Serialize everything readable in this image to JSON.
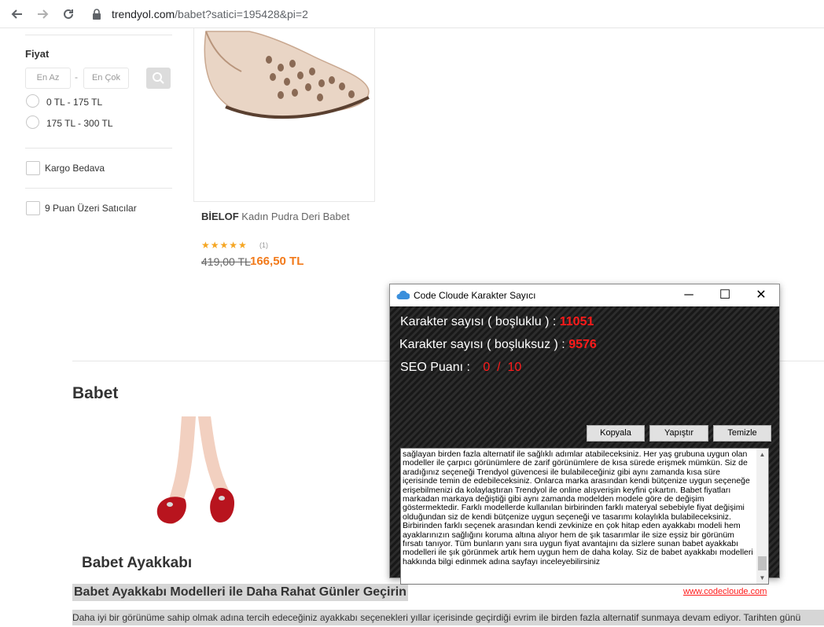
{
  "browser": {
    "back_icon": "arrow-left-icon",
    "forward_icon": "arrow-right-icon",
    "reload_icon": "reload-icon",
    "url_domain": "trendyol.com",
    "url_path": "/babet?satici=195428&pi=2"
  },
  "filters": {
    "price_title": "Fiyat",
    "min_placeholder": "En Az",
    "dash": "-",
    "max_placeholder": "En Çok",
    "ranges": [
      "0 TL - 175 TL",
      "175 TL - 300 TL"
    ],
    "free_shipping": "Kargo Bedava",
    "top_sellers": "9 Puan Üzeri Satıcılar"
  },
  "product": {
    "brand": "BİELOF",
    "name": "Kadın Pudra Deri Babet",
    "rating": 5,
    "stars": "★★★★★",
    "review_count": "(1)",
    "old_price": "419,00 TL",
    "new_price": "166,50 TL"
  },
  "content": {
    "title": "Babet",
    "subtitle": "Babet Ayakkabı",
    "heading": "Babet Ayakkabı Modelleri ile Daha Rahat Günler Geçirin",
    "paragraph": "Daha iyi bir görünüme sahip olmak adına tercih edeceğiniz ayakkabı seçenekleri yıllar içerisinde geçirdiği evrim ile birden fazla alternatif sunmaya devam ediyor. Tarihten günü"
  },
  "app": {
    "title": "Code Cloude Karakter Sayıcı",
    "minimize": "─",
    "maximize": "☐",
    "close": "✕",
    "with_spaces_label": "Karakter sayısı ( boşluklu ) :",
    "with_spaces_value": "11051",
    "without_spaces_label": "Karakter sayısı ( boşluksuz ) :",
    "without_spaces_value": "9576",
    "seo_label": "SEO Puanı :",
    "seo_value": "0  /  10",
    "copy_button": "Kopyala",
    "paste_button": "Yapıştır",
    "clear_button": "Temizle",
    "text": "sağlayan birden fazla alternatif ile sağlıklı adımlar atabileceksiniz. Her yaş grubuna uygun olan modeller ile çarpıcı görünümlere de zarif görünümlere de kısa sürede erişmek mümkün. Siz de aradığınız seçeneği Trendyol güvencesi ile bulabileceğiniz gibi aynı zamanda kısa süre içerisinde temin de edebileceksiniz. Onlarca marka arasından kendi bütçenize uygun seçeneğe erişebilmenizi da kolaylaştıran Trendyol ile online alışverişin keyfini çıkartın. Babet fiyatları markadan markaya değiştiği gibi aynı zamanda modelden modele göre de değişim göstermektedir. Farklı modellerde kullanılan birbirinden farklı materyal sebebiyle fiyat değişimi olduğundan siz de kendi bütçenize uygun seçeneği ve tasarımı kolaylıkla bulabileceksiniz. Birbirinden farklı seçenek arasından kendi zevkinize en çok hitap eden ayakkabı modeli hem ayaklarınızın sağlığını koruma altına alıyor hem de şık tasarımlar ile size eşsiz bir görünüm fırsatı tanıyor. Tüm bunların yanı sıra uygun fiyat avantajını da sizlere sunan babet ayakkabı modelleri ile şık görünmek artık hem uygun hem de daha kolay. Siz de babet ayakkabı modelleri hakkında bilgi edinmek adına sayfayı inceleyebilirsiniz",
    "footer_link": "www.codecloude.com"
  },
  "colors": {
    "accent_orange": "#f27a1a",
    "counter_red": "#ff1a1a",
    "star_yellow": "#f5a623"
  }
}
